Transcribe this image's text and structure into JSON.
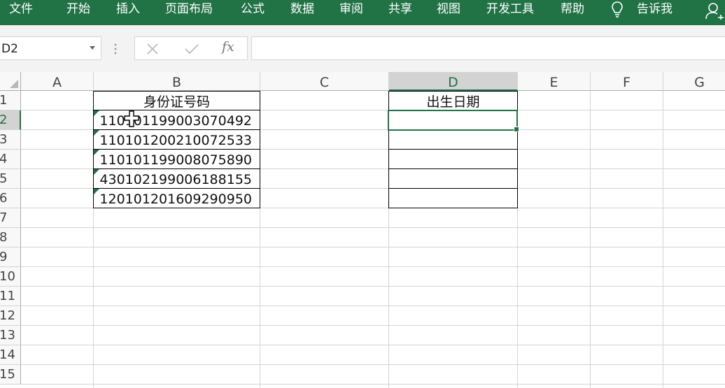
{
  "ribbon": {
    "tabs": [
      "文件",
      "开始",
      "插入",
      "页面布局",
      "公式",
      "数据",
      "审阅",
      "共享",
      "视图",
      "开发工具",
      "帮助"
    ],
    "tell_me": "告诉我",
    "bg_color": "#217346"
  },
  "formula_bar": {
    "name_box": "D2",
    "fx_label": "fx",
    "formula": ""
  },
  "grid": {
    "columns": [
      "A",
      "B",
      "C",
      "D",
      "E",
      "F",
      "G"
    ],
    "selected_column": "D",
    "rows": [
      "1",
      "2",
      "3",
      "4",
      "5",
      "6",
      "7",
      "8",
      "9",
      "10",
      "11",
      "12",
      "13",
      "14",
      "15"
    ],
    "selected_row": "2",
    "id_header": "身份证号码",
    "birth_header": "出生日期",
    "id_numbers": [
      "110101199003070492",
      "110101200210072533",
      "110101199008075890",
      "430102199006188155",
      "120101201609290950"
    ],
    "birth_dates": [
      "",
      "",
      "",
      "",
      ""
    ]
  }
}
